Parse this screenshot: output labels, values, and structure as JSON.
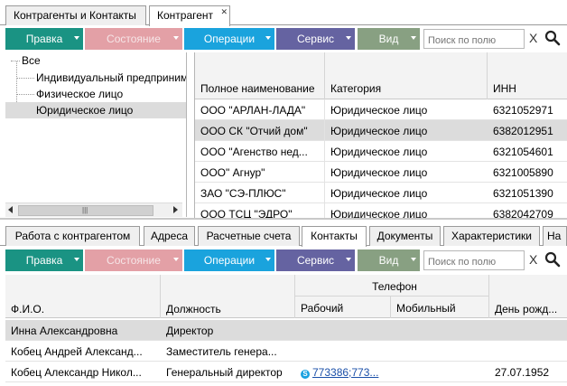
{
  "top_tabs": [
    {
      "label": "Контрагенты и Контакты",
      "active": false
    },
    {
      "label": "Контрагент",
      "active": true
    }
  ],
  "toolbar": {
    "edit_label": "Правка",
    "state_label": "Состояние",
    "ops_label": "Операции",
    "service_label": "Сервис",
    "view_label": "Вид",
    "search_placeholder": "Поиск по полю",
    "clear_label": "X"
  },
  "colors": {
    "edit": "#1a9383",
    "state": "#e3a0a6",
    "ops": "#1aa3dd",
    "service": "#6563a1",
    "view": "#88a082"
  },
  "tree": {
    "root": "Все",
    "items": [
      "Индивидуальный предприниматель",
      "Физическое лицо",
      "Юридическое лицо"
    ],
    "selected_index": 2
  },
  "grid": {
    "columns": [
      "Полное наименование",
      "Категория",
      "ИНН"
    ],
    "rows": [
      [
        "ООО \"АРЛАН-ЛАДА\"",
        "Юридическое лицо",
        "6321052971"
      ],
      [
        "ООО СК \"Отчий дом\"",
        "Юридическое лицо",
        "6382012951"
      ],
      [
        "ООО \"Агенство нед...",
        "Юридическое лицо",
        "6321054601"
      ],
      [
        "ООО\" Агнур\"",
        "Юридическое лицо",
        "6321005890"
      ],
      [
        "ЗАО \"СЭ-ПЛЮС\"",
        "Юридическое лицо",
        "6321051390"
      ],
      [
        "ООО ТСЦ \"ЭДРО\"",
        "Юридическое лицо",
        "6382042709"
      ]
    ],
    "selected_index": 1
  },
  "bottom_tabs": [
    {
      "label": "Работа с контрагентом",
      "active": false
    },
    {
      "label": "Адреса",
      "active": false
    },
    {
      "label": "Расчетные счета",
      "active": false
    },
    {
      "label": "Контакты",
      "active": true
    },
    {
      "label": "Документы",
      "active": false
    },
    {
      "label": "Характеристики",
      "active": false
    },
    {
      "label": "На",
      "active": false
    }
  ],
  "contacts": {
    "group_header": "Телефон",
    "columns": [
      "Ф.И.О.",
      "Должность",
      "Рабочий",
      "Мобильный",
      "День рожд..."
    ],
    "rows": [
      {
        "name": "Инна Александровна",
        "position": "Директор",
        "work_phone": "",
        "mobile": "",
        "birthday": ""
      },
      {
        "name": "Кобец Андрей Александ...",
        "position": "Заместитель генера...",
        "work_phone": "",
        "mobile": "",
        "birthday": ""
      },
      {
        "name": "Кобец Александр Никол...",
        "position": "Генеральный директор",
        "work_phone": "773386;773...",
        "mobile": "",
        "birthday": "27.07.1952"
      }
    ],
    "selected_index": 0
  },
  "icons": {
    "search": "magnifier-icon",
    "skype": "skype-icon",
    "scroll_left": "arrow-left-icon",
    "scroll_right": "arrow-right-icon",
    "dropdown": "caret-down-icon"
  }
}
